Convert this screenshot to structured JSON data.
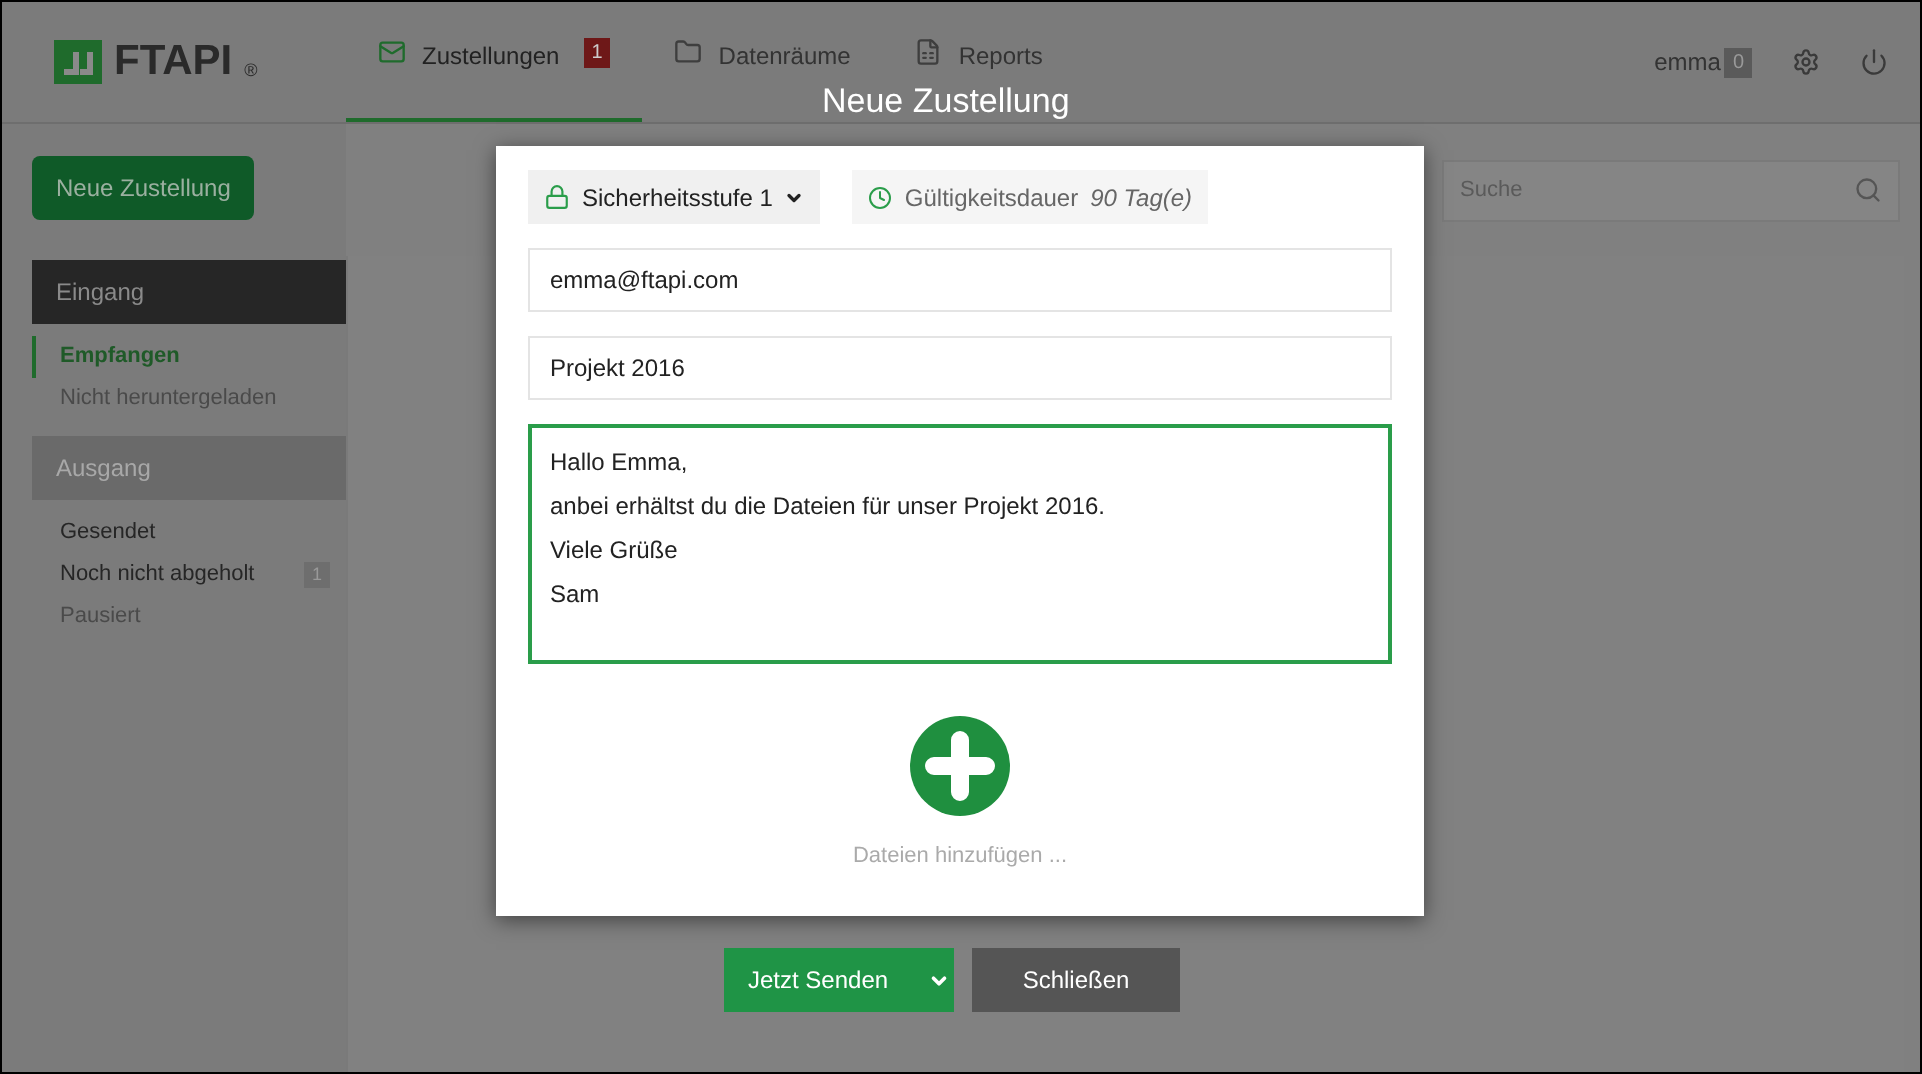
{
  "header": {
    "logo": "FTAPI",
    "logo_mark": "®",
    "tabs": [
      {
        "label": "Zustellungen",
        "badge": "1",
        "selected": true
      },
      {
        "label": "Datenräume",
        "selected": false
      },
      {
        "label": "Reports",
        "selected": false
      }
    ],
    "user": "emma",
    "user_badge": "0"
  },
  "sidebar": {
    "new_button": "Neue Zustellung",
    "sections": [
      {
        "title": "Eingang",
        "selected": true,
        "items": [
          {
            "label": "Empfangen",
            "selected": true,
            "disabled": false
          },
          {
            "label": "Nicht heruntergeladen",
            "selected": false,
            "disabled": true
          }
        ]
      },
      {
        "title": "Ausgang",
        "selected": false,
        "items": [
          {
            "label": "Gesendet",
            "selected": false,
            "disabled": false
          },
          {
            "label": "Noch nicht abgeholt",
            "selected": false,
            "disabled": false,
            "badge": "1"
          },
          {
            "label": "Pausiert",
            "selected": false,
            "disabled": true
          }
        ]
      }
    ]
  },
  "search": {
    "placeholder": "Suche"
  },
  "dialog": {
    "title": "Neue Zustellung",
    "security": "Sicherheitsstufe 1",
    "validity_label": "Gültigkeitsdauer",
    "validity_value": "90 Tag(e)",
    "recipient": "emma@ftapi.com",
    "subject": "Projekt 2016",
    "message": [
      "Hallo Emma,",
      "anbei erhältst du die Dateien für unser Projekt 2016.",
      "Viele Grüße",
      "Sam"
    ],
    "add_files": "Dateien hinzufügen ...",
    "send_button": "Jetzt Senden",
    "close_button": "Schließen"
  }
}
